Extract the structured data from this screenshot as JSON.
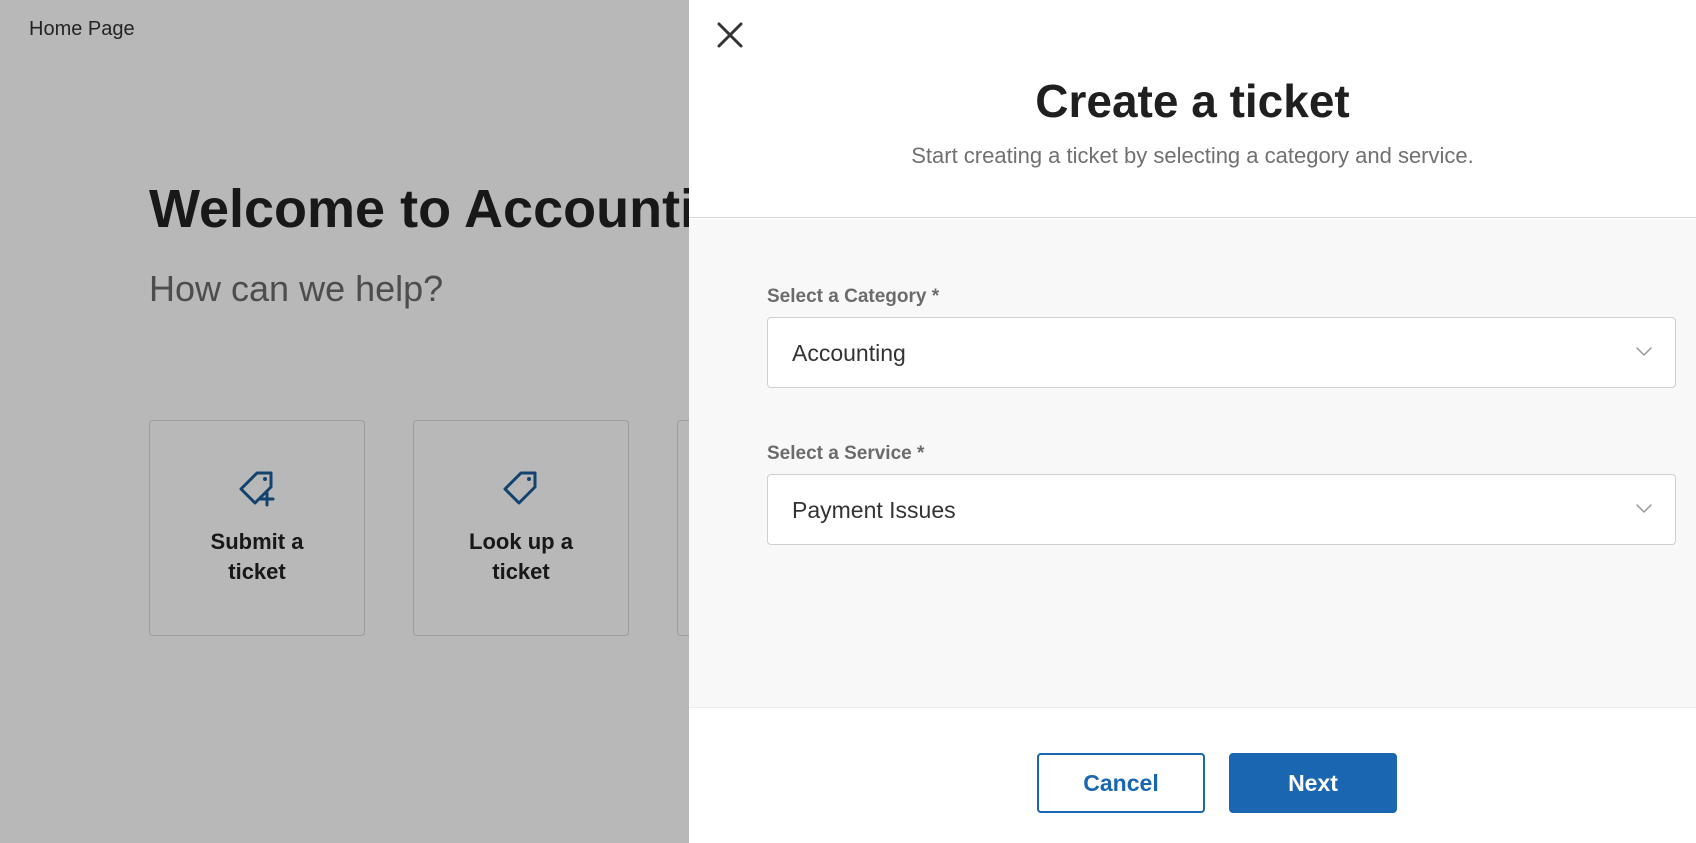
{
  "background": {
    "breadcrumb": "Home Page",
    "welcome_title": "Welcome to Accountin",
    "subtitle": "How can we help?",
    "tiles": [
      {
        "label": "Submit a ticket",
        "icon": "tag-plus-icon"
      },
      {
        "label": "Look up a ticket",
        "icon": "tag-icon"
      },
      {
        "label": ""
      }
    ]
  },
  "drawer": {
    "close_icon": "close-icon",
    "title": "Create a ticket",
    "subtitle": "Start creating a ticket by selecting a category and service.",
    "category": {
      "label": "Select a Category *",
      "value": "Accounting"
    },
    "service": {
      "label": "Select a Service *",
      "value": "Payment Issues"
    },
    "cancel_label": "Cancel",
    "next_label": "Next"
  },
  "colors": {
    "accent": "#1a66b0",
    "overlay": "rgba(0,0,0,0.28)",
    "body_bg": "#f8f8f8"
  }
}
